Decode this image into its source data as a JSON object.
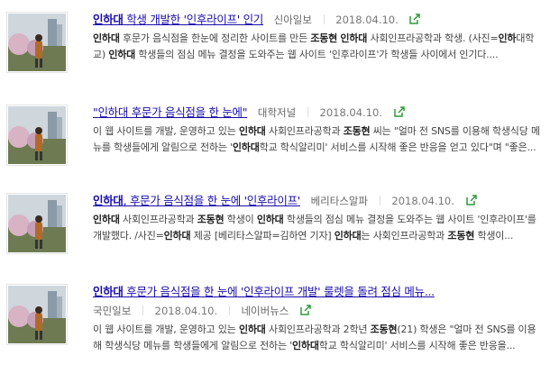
{
  "colors": {
    "link": "#1a0dab",
    "share_icon": "#2e9a3c"
  },
  "items": [
    {
      "title_parts": [
        {
          "t": "인하대",
          "b": true
        },
        {
          "t": " 학생 개발한 '인후라이프' 인기",
          "b": false
        }
      ],
      "press": "신아일보",
      "date": "2018.04.10.",
      "press_on_second_line": false,
      "desc_parts": [
        {
          "t": "인하대",
          "b": true
        },
        {
          "t": " 후문가 음식점을 한눈에 정리한 사이트를 만든 ",
          "b": false
        },
        {
          "t": "조동현",
          "b": true
        },
        {
          "t": " ",
          "b": false
        },
        {
          "t": "인하대",
          "b": true
        },
        {
          "t": " 사회인프라공학과 학생. (사진=",
          "b": false
        },
        {
          "t": "인하",
          "b": true
        },
        {
          "t": "대학교) ",
          "b": false
        },
        {
          "t": "인하대",
          "b": true
        },
        {
          "t": " 학생들의 점심 메뉴 결정을 도와주는 웹 사이트 '인후라이프'가 학생들 사이에서 인기다....",
          "b": false
        }
      ]
    },
    {
      "title_parts": [
        {
          "t": "\"인하대 후문가 음식점을 한 눈에\"",
          "b": false
        }
      ],
      "press": "대학저널",
      "date": "2018.04.10.",
      "press_on_second_line": false,
      "desc_parts": [
        {
          "t": "이 웹 사이트를 개발, 운영하고 있는 ",
          "b": false
        },
        {
          "t": "인하대",
          "b": true
        },
        {
          "t": " 사회인프라공학과 ",
          "b": false
        },
        {
          "t": "조동현",
          "b": true
        },
        {
          "t": " 씨는 \"얼마 전 SNS를 이용해 학생식당 메뉴를 학생들에게 알림으로 전하는 '",
          "b": false
        },
        {
          "t": "인하대",
          "b": true
        },
        {
          "t": "학교 학식알리미' 서비스를 시작해 좋은 반응을 얻고 있다\"며 \"좋은...",
          "b": false
        }
      ]
    },
    {
      "title_parts": [
        {
          "t": "인하대",
          "b": true
        },
        {
          "t": ", 후문가 음식점을 한 눈에 '인후라이프'",
          "b": false
        }
      ],
      "press": "베리타스알파",
      "date": "2018.04.10.",
      "press_on_second_line": false,
      "desc_parts": [
        {
          "t": "인하대",
          "b": true
        },
        {
          "t": " 사회인프라공학과 ",
          "b": false
        },
        {
          "t": "조동현",
          "b": true
        },
        {
          "t": " 학생이 ",
          "b": false
        },
        {
          "t": "인하대",
          "b": true
        },
        {
          "t": " 학생들의 점심 메뉴 결정을 도와주는 웹 사이트 '인후라이프'를 개발했다. /사진=",
          "b": false
        },
        {
          "t": "인하대",
          "b": true
        },
        {
          "t": " 제공 [베리타스알파=김하연 기자] ",
          "b": false
        },
        {
          "t": "인하대",
          "b": true
        },
        {
          "t": "는 사회인프라공학과 ",
          "b": false
        },
        {
          "t": "조동현",
          "b": true
        },
        {
          "t": " 학생이...",
          "b": false
        }
      ]
    },
    {
      "title_parts": [
        {
          "t": "인하대",
          "b": true
        },
        {
          "t": " 후문가 음식점을 한 눈에 '인후라이프 개발' 룰렛을 돌려 점심 메뉴...",
          "b": false
        }
      ],
      "press": "국민일보",
      "date": "2018.04.10.",
      "extra": "네이버뉴스",
      "press_on_second_line": true,
      "desc_parts": [
        {
          "t": "이 웹 사이트를 개발, 운영하고 있는 ",
          "b": false
        },
        {
          "t": "인하대",
          "b": true
        },
        {
          "t": " 사회인프라공학과 2학년 ",
          "b": false
        },
        {
          "t": "조동현",
          "b": true
        },
        {
          "t": "(21) 학생은 \"얼마 전 SNS를 이용해 학생식당 메뉴를 학생들에게 알림으로 전하는 '",
          "b": false
        },
        {
          "t": "인하대",
          "b": true
        },
        {
          "t": "학교 학식알리미' 서비스를 시작해 좋은 반응을...",
          "b": false
        }
      ]
    }
  ]
}
